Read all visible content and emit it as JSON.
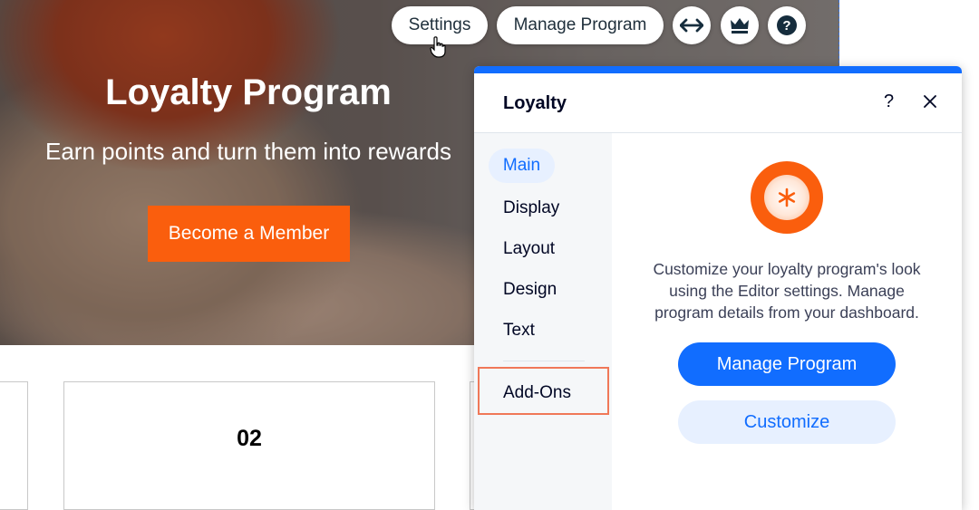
{
  "hero": {
    "title": "Loyalty Program",
    "subtitle": "Earn points and turn them into rewards",
    "cta_label": "Become a Member"
  },
  "toolbar": {
    "settings_label": "Settings",
    "manage_label": "Manage Program",
    "icons": [
      "stretch-icon",
      "crown-icon",
      "help-icon"
    ]
  },
  "cards": [
    {
      "number": ""
    },
    {
      "number": "02"
    },
    {
      "number": ""
    }
  ],
  "panel": {
    "title": "Loyalty",
    "help_glyph": "?",
    "nav": [
      {
        "label": "Main",
        "active": true
      },
      {
        "label": "Display"
      },
      {
        "label": "Layout"
      },
      {
        "label": "Design"
      },
      {
        "label": "Text"
      },
      {
        "label": "Add-Ons"
      }
    ],
    "description": "Customize your loyalty program's look using the Editor settings. Manage program details from your dashboard.",
    "primary_button": "Manage Program",
    "secondary_button": "Customize"
  },
  "colors": {
    "accent_blue": "#116dff",
    "accent_light": "#e7f0ff",
    "brand_orange": "#fa5e0d",
    "highlight_box": "#f07858"
  }
}
